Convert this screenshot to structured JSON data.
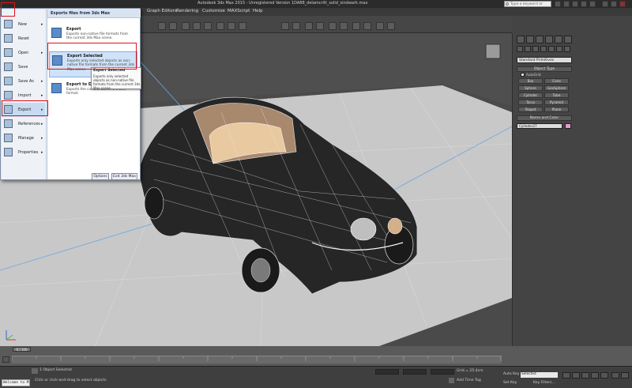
{
  "titlebar": {
    "title": "Autodesk 3ds Max 2015 - Unregistered Version   1DA88_delamcritt_solid_sindwark.max",
    "search_placeholder": "Type a keyword or phrase"
  },
  "menubar": {
    "items": [
      "Graph Editors",
      "Rendering",
      "Customize",
      "MAXScript",
      "Help"
    ]
  },
  "toolbar": {
    "selection_set": "Create Selection Se"
  },
  "command_panel": {
    "category": "Standard Primitives",
    "object_type_title": "Object Type",
    "autogrid_label": "AutoGrid",
    "primitives": [
      "Box",
      "Cone",
      "Sphere",
      "GeoSphere",
      "Cylinder",
      "Tube",
      "Torus",
      "Pyramid",
      "Teapot",
      "Plane"
    ],
    "name_color_title": "Name and Color",
    "object_name": "Cylinder27",
    "object_color": "#e39bd2"
  },
  "app_menu": {
    "left_items": [
      {
        "label": "New",
        "has_submenu": true
      },
      {
        "label": "Reset",
        "has_submenu": false
      },
      {
        "label": "Open",
        "has_submenu": true
      },
      {
        "label": "Save",
        "has_submenu": false
      },
      {
        "label": "Save As",
        "has_submenu": true
      },
      {
        "label": "Import",
        "has_submenu": true
      },
      {
        "label": "Export",
        "has_submenu": true
      },
      {
        "label": "References",
        "has_submenu": true
      },
      {
        "label": "Manage",
        "has_submenu": true
      },
      {
        "label": "Properties",
        "has_submenu": true
      }
    ],
    "right_header": "Exports files from 3ds Max",
    "sub_items": [
      {
        "title": "Export",
        "description": "Exports non-native file formats from the current 3ds Max scene."
      },
      {
        "title": "Export Selected",
        "description": "Exports only selected objects as non-native file formats from the current 3ds Max scene."
      },
      {
        "title": "Export to DWF",
        "description": "Exports the current scene to a DWF format."
      }
    ],
    "options_label": "Options",
    "exit_label": "Exit 3ds Max",
    "tooltip_title": "Export Selected",
    "tooltip_text": "Exports only selected objects as non-native file formats from the current 3ds Max scene."
  },
  "timeline": {
    "slider_label": "0 / 100"
  },
  "status": {
    "selection_text": "1 Object Selected",
    "prompt_text": "Click or click-and-drag to select objects",
    "grid_text": "Grid = 25.4cm",
    "add_time_tag": "Add Time Tag",
    "auto_key": "Auto Key",
    "set_key": "Set Key",
    "key_mode": "Selected",
    "key_filters": "Key Filters...",
    "listener": "Welcome to M"
  },
  "colors": {
    "highlight_border": "#e0131b",
    "viewport_bg": "#4f4f4f",
    "ground_plane": "#c7c7c7"
  }
}
